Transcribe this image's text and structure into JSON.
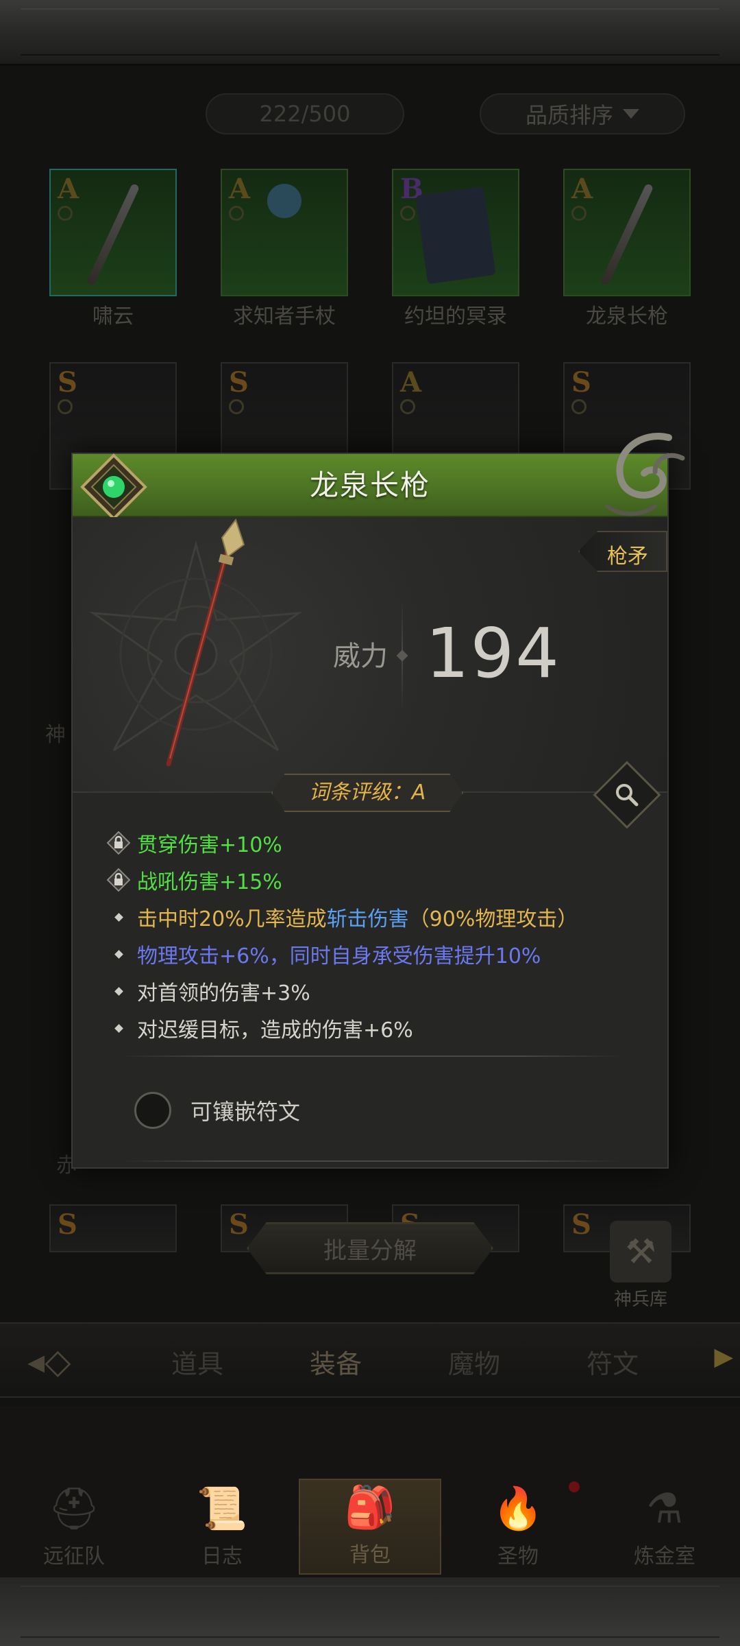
{
  "inventory": {
    "count_text": "222/500",
    "sort_label": "品质排序",
    "items": [
      {
        "grade": "A",
        "name": "啸云"
      },
      {
        "grade": "A",
        "name": "求知者手杖"
      },
      {
        "grade": "B",
        "name": "约坦的冥录"
      },
      {
        "grade": "A",
        "name": "龙泉长枪"
      },
      {
        "grade": "S",
        "name": ""
      },
      {
        "grade": "S",
        "name": ""
      },
      {
        "grade": "A",
        "name": ""
      },
      {
        "grade": "S",
        "name": ""
      },
      {
        "grade": "S",
        "name": ""
      },
      {
        "grade": "S",
        "name": ""
      },
      {
        "grade": "S",
        "name": ""
      },
      {
        "grade": "S",
        "name": ""
      }
    ],
    "side_fragments": [
      "神",
      "赤"
    ],
    "bulk_decompose_label": "批量分解",
    "armory_label": "神兵库"
  },
  "category_tabs": [
    "道具",
    "装备",
    "魔物",
    "符文"
  ],
  "active_category": "装备",
  "main_nav": [
    {
      "label": "远征队",
      "icon": "helmet-icon"
    },
    {
      "label": "日志",
      "icon": "scroll-icon"
    },
    {
      "label": "背包",
      "icon": "backpack-icon"
    },
    {
      "label": "圣物",
      "icon": "torch-icon"
    },
    {
      "label": "炼金室",
      "icon": "alchemy-icon"
    }
  ],
  "active_nav": "背包",
  "modal": {
    "title": "龙泉长枪",
    "type_tag": "枪矛",
    "power_label": "威力",
    "power_value": "194",
    "rating_label": "词条评级：A",
    "affixes": [
      {
        "locked": true,
        "parts": [
          {
            "text": "贯穿伤害+10%",
            "color": "#52e043"
          }
        ]
      },
      {
        "locked": true,
        "parts": [
          {
            "text": "战吼伤害+15%",
            "color": "#52e043"
          }
        ]
      },
      {
        "locked": false,
        "parts": [
          {
            "text": "击中时20%几率造成",
            "color": "#e4b64e"
          },
          {
            "text": "斩击伤害",
            "color": "#5aa0f5"
          },
          {
            "text": "（90%物理攻击）",
            "color": "#e4b64e"
          }
        ]
      },
      {
        "locked": false,
        "parts": [
          {
            "text": "物理攻击+6%，同时自身承受伤害提升10%",
            "color": "#6b78f0"
          }
        ]
      },
      {
        "locked": false,
        "parts": [
          {
            "text": "对首领的伤害+3%",
            "color": "#d6d4cc"
          }
        ]
      },
      {
        "locked": false,
        "parts": [
          {
            "text": "对迟缓目标，造成的伤害+6%",
            "color": "#d6d4cc"
          }
        ]
      }
    ],
    "rune_slot_label": "可镶嵌符文",
    "header_color": "#4d7424"
  }
}
